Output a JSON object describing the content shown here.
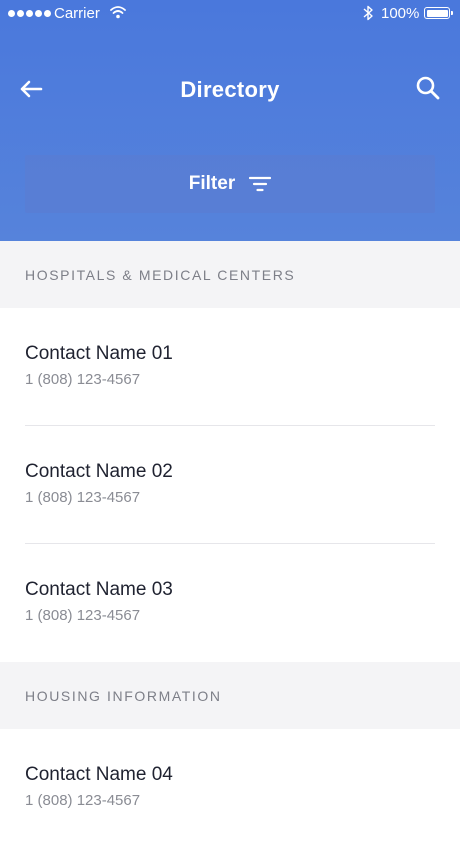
{
  "status_bar": {
    "carrier": "Carrier",
    "battery": "100%",
    "icons": [
      "signal-dots-icon",
      "wifi-icon",
      "bluetooth-icon",
      "battery-icon"
    ]
  },
  "nav": {
    "title": "Directory",
    "back_icon": "arrow-left-icon",
    "search_icon": "search-icon"
  },
  "filter": {
    "label": "Filter",
    "icon": "filter-lines-icon"
  },
  "colors": {
    "header_blue": "#4f7edb",
    "section_bg": "#f4f4f6",
    "text_dark": "#1f2230",
    "text_muted": "#8a8c94"
  },
  "sections": [
    {
      "title": "HOSPITALS & MEDICAL CENTERS",
      "contacts": [
        {
          "name": "Contact Name 01",
          "phone": "1 (808) 123-4567"
        },
        {
          "name": "Contact Name 02",
          "phone": "1 (808) 123-4567"
        },
        {
          "name": "Contact Name 03",
          "phone": "1 (808) 123-4567"
        }
      ]
    },
    {
      "title": "HOUSING INFORMATION",
      "contacts": [
        {
          "name": "Contact Name 04",
          "phone": "1 (808) 123-4567"
        }
      ]
    }
  ]
}
